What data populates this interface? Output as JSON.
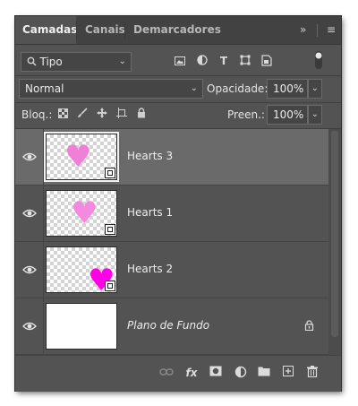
{
  "tabs": [
    {
      "label": "Camadas",
      "active": true
    },
    {
      "label": "Canais",
      "active": false
    },
    {
      "label": "Demarcadores",
      "active": false
    }
  ],
  "tab_icons": {
    "expand": "»",
    "menu": "≡"
  },
  "filter": {
    "search_icon": "Q",
    "kind": "Tipo"
  },
  "filter_icons": [
    "image-filter-icon",
    "adjustment-filter-icon",
    "type-filter-icon",
    "shape-filter-icon",
    "smart-object-filter-icon",
    "filter-toggle-icon"
  ],
  "blend": {
    "mode": "Normal",
    "opacity_label": "Opacidade:",
    "opacity_value": "100%"
  },
  "lock": {
    "label": "Bloq.:",
    "fill_label": "Preen.:",
    "fill_value": "100%"
  },
  "layers": [
    {
      "name": "Hearts 3",
      "selected": true,
      "heart_color": "#f07fd8",
      "smart_object": true
    },
    {
      "name": "Hearts 1",
      "selected": false,
      "heart_color": "#f48ae0",
      "smart_object": true
    },
    {
      "name": "Hearts 2",
      "selected": false,
      "heart_color": "#ff00e6",
      "smart_object": true
    },
    {
      "name": "Plano de Fundo",
      "selected": false,
      "background": true,
      "locked": true
    }
  ],
  "footer_icons": [
    "link-icon",
    "fx-icon",
    "mask-icon",
    "adjustment-icon",
    "group-folder-icon",
    "new-layer-icon",
    "trash-icon"
  ],
  "footer_fx": "fx"
}
